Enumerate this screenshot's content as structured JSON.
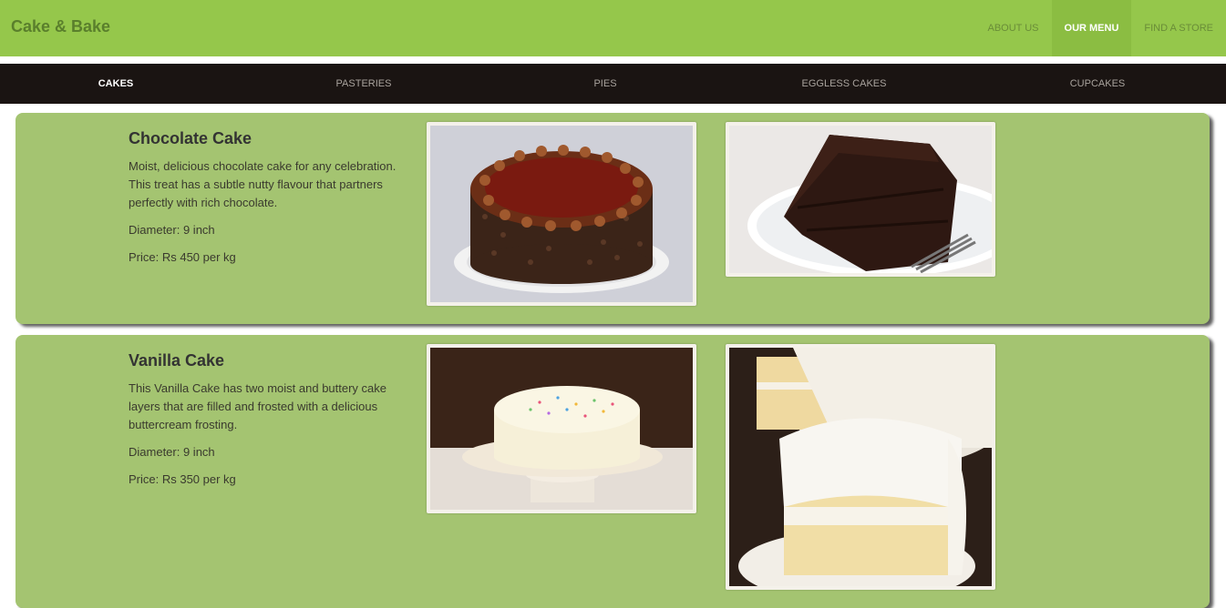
{
  "brand": "Cake & Bake",
  "topnav": [
    {
      "label": "ABOUT US"
    },
    {
      "label": "OUR MENU",
      "active": true
    },
    {
      "label": "FIND A STORE"
    }
  ],
  "categories": [
    {
      "label": "CAKES",
      "active": true
    },
    {
      "label": "PASTERIES"
    },
    {
      "label": "PIES"
    },
    {
      "label": "EGGLESS CAKES"
    },
    {
      "label": "CUPCAKES"
    }
  ],
  "products": [
    {
      "name": "Chocolate Cake",
      "description": "Moist, delicious chocolate cake for any celebration. This treat has a subtle nutty flavour that partners perfectly with rich chocolate.",
      "diameter": "Diameter: 9 inch",
      "price": "Price: Rs 450 per kg",
      "images": [
        "whole chocolate cake photo",
        "chocolate cake slice photo"
      ]
    },
    {
      "name": "Vanilla Cake",
      "description": "This Vanilla Cake has two moist and buttery cake layers that are filled and frosted with a delicious buttercream frosting.",
      "diameter": "Diameter: 9 inch",
      "price": "Price: Rs 350 per kg",
      "images": [
        "whole vanilla cake photo",
        "vanilla cake slice photo"
      ]
    }
  ],
  "colors": {
    "header_green": "#95c74b",
    "active_nav": "#8bbd42",
    "category_bar": "#1a1412",
    "card_green": "#a4c471"
  }
}
